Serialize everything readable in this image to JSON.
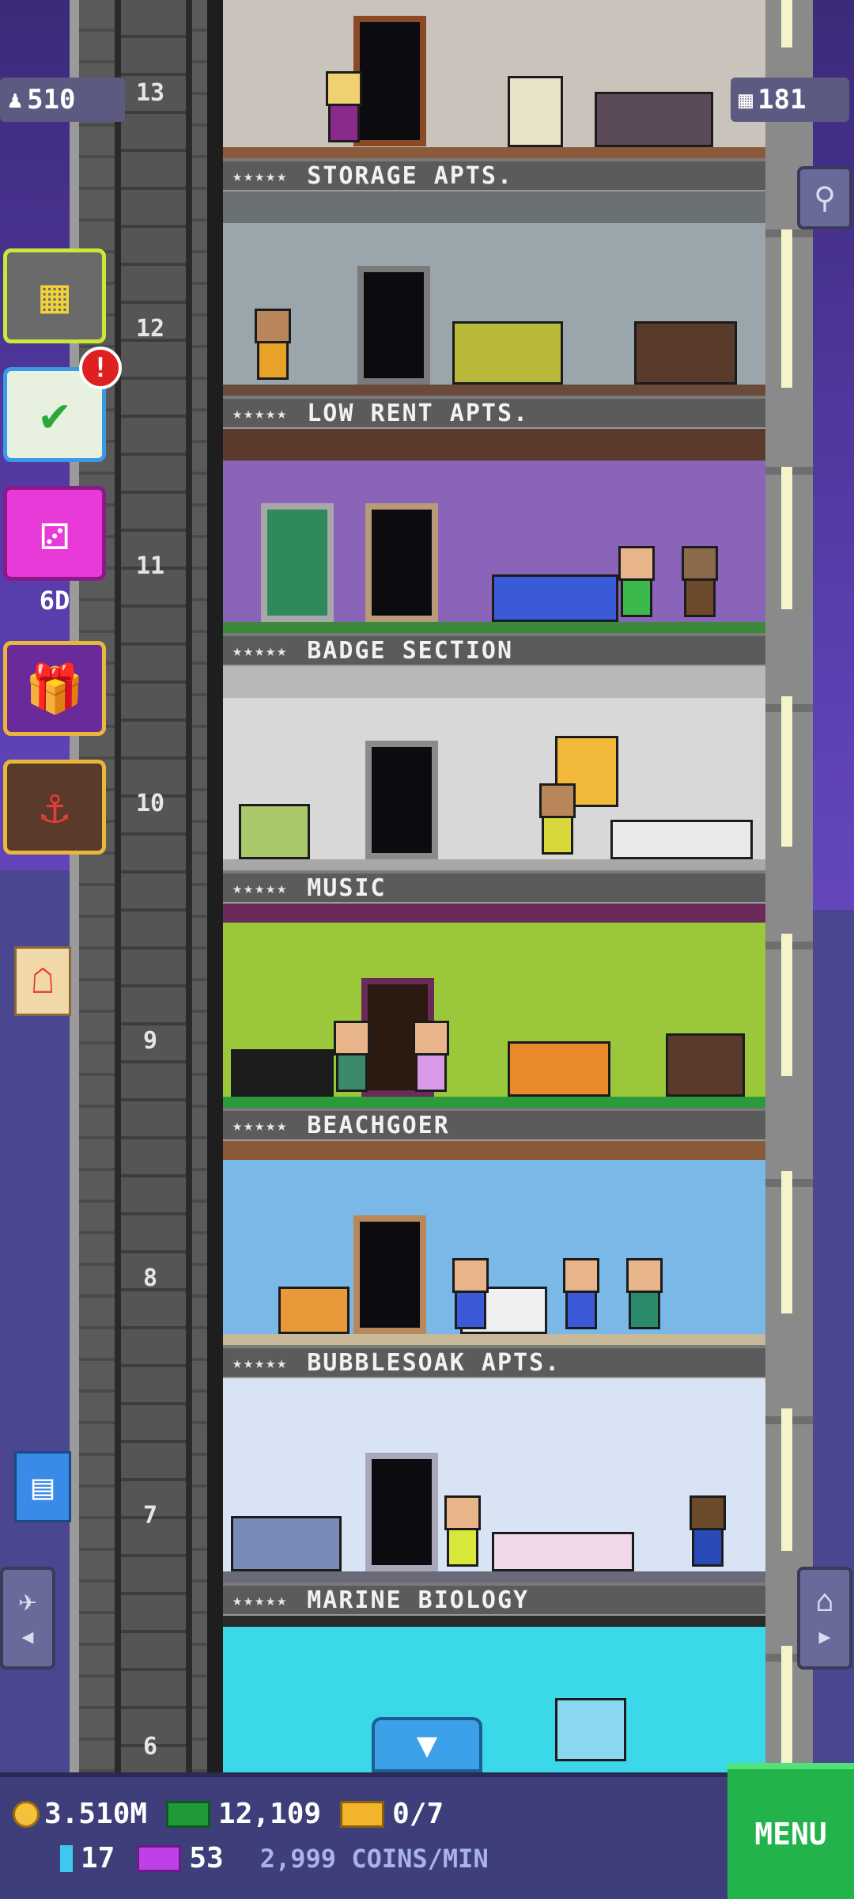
{
  "top": {
    "population": "510",
    "floors_count": "181"
  },
  "floors": [
    {
      "number": "13",
      "name": "STORAGE APTS.",
      "stars": "★★★★★"
    },
    {
      "number": "12",
      "name": "LOW RENT APTS.",
      "stars": "★★★★★"
    },
    {
      "number": "11",
      "name": "BADGE SECTION",
      "stars": "★★★★★"
    },
    {
      "number": "10",
      "name": "MUSIC",
      "stars": "★★★★★"
    },
    {
      "number": "9",
      "name": "BEACHGOER",
      "stars": "★★★★★"
    },
    {
      "number": "8",
      "name": "BUBBLESOAK APTS.",
      "stars": "★★★★★"
    },
    {
      "number": "7",
      "name": "MARINE BIOLOGY",
      "stars": "★★★★★"
    },
    {
      "number": "6",
      "name": "",
      "stars": ""
    }
  ],
  "side": {
    "dice_timer": "6D",
    "alert_badge": "!"
  },
  "hud": {
    "coins": "3.510M",
    "bux": "12,109",
    "tickets": "0/7",
    "gems": "17",
    "vip": "53",
    "rate": "2,999 COINS/MIN",
    "menu_label": "MENU"
  },
  "icons": [
    "population-icon",
    "floors-icon",
    "search-icon",
    "tower-overview-icon",
    "mission-checklist-icon",
    "dice-icon",
    "gift-icon",
    "shop-stall-icon",
    "fries-ad-icon",
    "chat-icon",
    "elevator-down-icon",
    "home-icon",
    "airplane-icon"
  ]
}
